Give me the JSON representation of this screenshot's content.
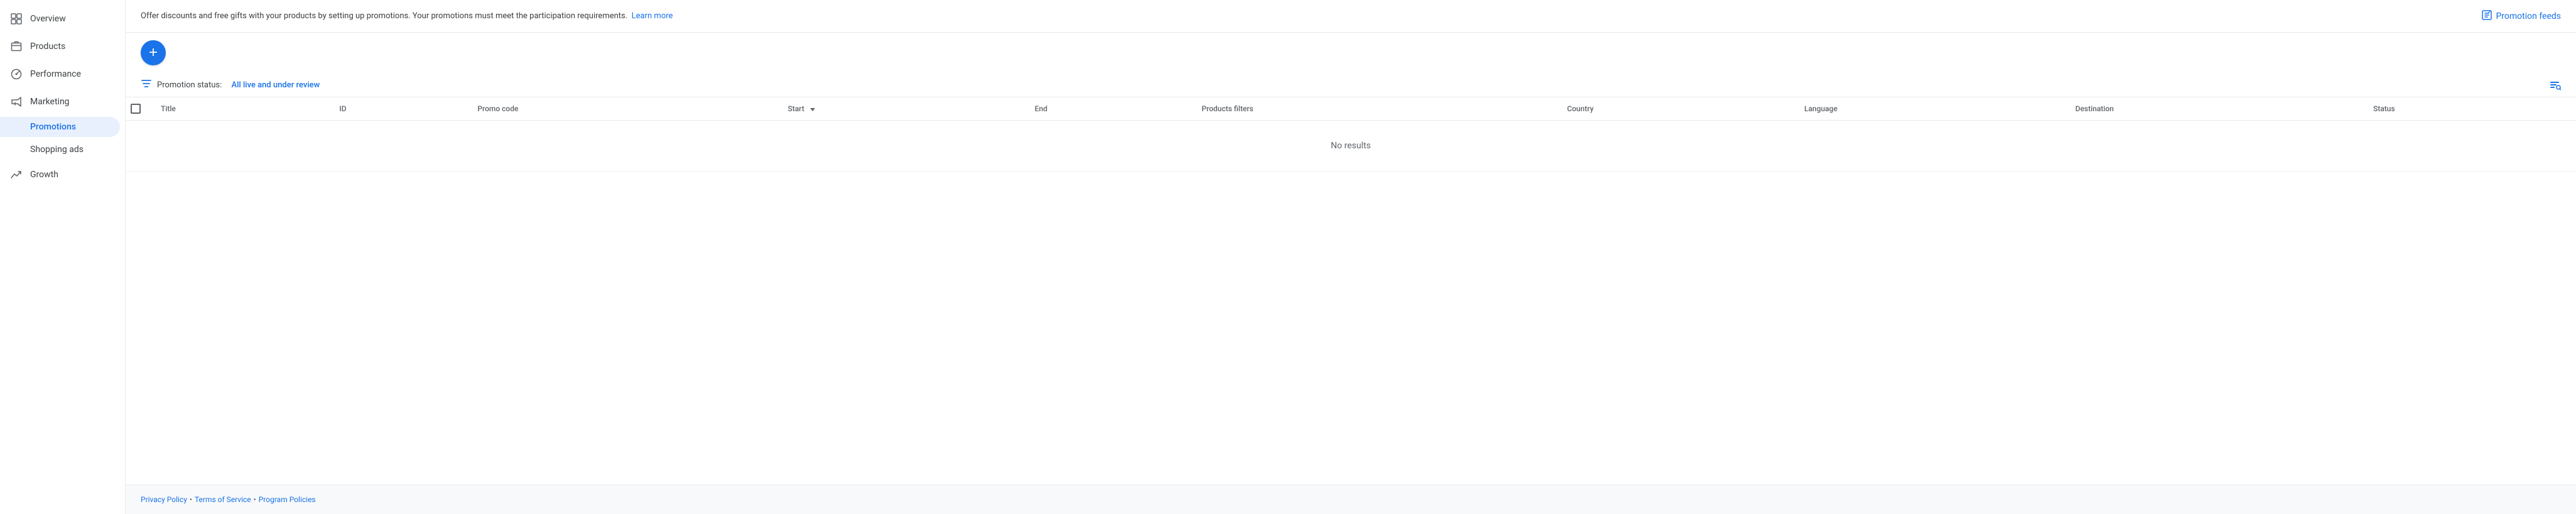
{
  "sidebar": {
    "items": [
      {
        "id": "overview",
        "label": "Overview",
        "icon": "grid",
        "active": false
      },
      {
        "id": "products",
        "label": "Products",
        "icon": "package",
        "active": false
      },
      {
        "id": "performance",
        "label": "Performance",
        "icon": "chart",
        "active": false
      },
      {
        "id": "marketing",
        "label": "Marketing",
        "icon": "tag",
        "active": false,
        "expanded": true
      }
    ],
    "sub_items": [
      {
        "id": "promotions",
        "label": "Promotions",
        "active": true
      },
      {
        "id": "shopping-ads",
        "label": "Shopping ads",
        "active": false
      }
    ],
    "growth_item": {
      "id": "growth",
      "label": "Growth",
      "icon": "trending-up"
    }
  },
  "header": {
    "description": "Offer discounts and free gifts with your products by setting up promotions. Your promotions must meet the participation requirements.",
    "learn_more": "Learn more",
    "promotion_feeds": "Promotion feeds"
  },
  "action_bar": {
    "add_button_label": "+"
  },
  "filter": {
    "label": "Promotion status:",
    "value": "All live and under review"
  },
  "table": {
    "columns": [
      "Title",
      "ID",
      "Promo code",
      "Start",
      "End",
      "Products filters",
      "Country",
      "Language",
      "Destination",
      "Status"
    ],
    "no_results": "No results"
  },
  "footer": {
    "links": [
      {
        "label": "Privacy Policy",
        "url": "#"
      },
      {
        "label": "Terms of Service",
        "url": "#"
      },
      {
        "label": "Program Policies",
        "url": "#"
      }
    ]
  }
}
